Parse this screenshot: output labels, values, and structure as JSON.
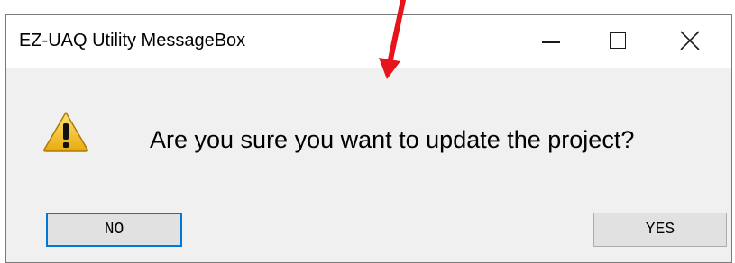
{
  "window": {
    "title": "EZ-UAQ Utility MessageBox",
    "controls": {
      "minimize_icon": "minimize-icon",
      "maximize_icon": "maximize-icon",
      "close_icon": "close-icon"
    }
  },
  "dialog": {
    "icon": "warning-icon",
    "message": "Are you sure you want to update the project?",
    "buttons": {
      "no_label": "NO",
      "yes_label": "YES"
    }
  },
  "annotation": {
    "icon": "red-arrow-icon",
    "color": "#e8141c"
  },
  "colors": {
    "focus_border": "#0078d7",
    "dialog_bg": "#f0f0f0",
    "warning_fill": "#f5c518"
  }
}
